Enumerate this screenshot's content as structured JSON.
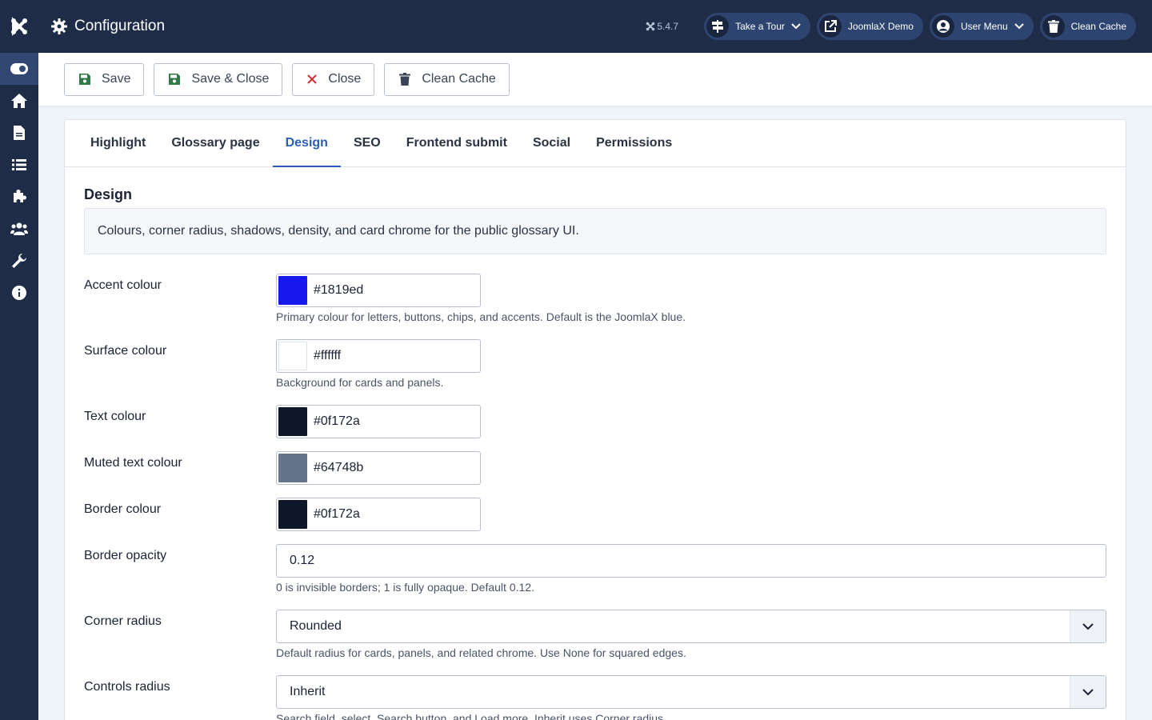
{
  "header": {
    "title": "Configuration",
    "version": "5.4.7",
    "buttons": [
      {
        "label": "Take a Tour",
        "icon": "signpost-icon",
        "dropdown": true
      },
      {
        "label": "JoomlaX Demo",
        "icon": "external-link-icon",
        "dropdown": false
      },
      {
        "label": "User Menu",
        "icon": "user-circle-icon",
        "dropdown": true
      },
      {
        "label": "Clean Cache",
        "icon": "trash-icon",
        "dropdown": false
      }
    ]
  },
  "sidebar": {
    "items": [
      "toggle-menu-icon",
      "home-icon",
      "article-icon",
      "list-icon",
      "extensions-icon",
      "users-icon",
      "tools-icon",
      "info-icon"
    ]
  },
  "toolbar": {
    "save_label": "Save",
    "save_close_label": "Save & Close",
    "close_label": "Close",
    "clean_cache_label": "Clean Cache"
  },
  "tabs": [
    "Highlight",
    "Glossary page",
    "Design",
    "SEO",
    "Frontend submit",
    "Social",
    "Permissions"
  ],
  "active_tab": "Design",
  "section": {
    "title": "Design",
    "description": "Colours, corner radius, shadows, density, and card chrome for the public glossary UI."
  },
  "fields": {
    "accent": {
      "label": "Accent colour",
      "value": "#1819ed",
      "help": "Primary colour for letters, buttons, chips, and accents. Default is the JoomlaX blue."
    },
    "surface": {
      "label": "Surface colour",
      "value": "#ffffff",
      "help": "Background for cards and panels."
    },
    "text": {
      "label": "Text colour",
      "value": "#0f172a"
    },
    "muted": {
      "label": "Muted text colour",
      "value": "#64748b"
    },
    "border": {
      "label": "Border colour",
      "value": "#0f172a"
    },
    "border_opacity": {
      "label": "Border opacity",
      "value": "0.12",
      "help": "0 is invisible borders; 1 is fully opaque. Default 0.12."
    },
    "corner_radius": {
      "label": "Corner radius",
      "value": "Rounded",
      "help": "Default radius for cards, panels, and related chrome. Use None for squared edges."
    },
    "controls_radius": {
      "label": "Controls radius",
      "value": "Inherit",
      "help": "Search field, select, Search button, and Load more. Inherit uses Corner radius."
    }
  },
  "colors": {
    "header_bg": "#1f2c48",
    "active_tab": "#2a5fb8",
    "save_icon": "#2f7a45",
    "close_icon": "#d22f2f"
  }
}
